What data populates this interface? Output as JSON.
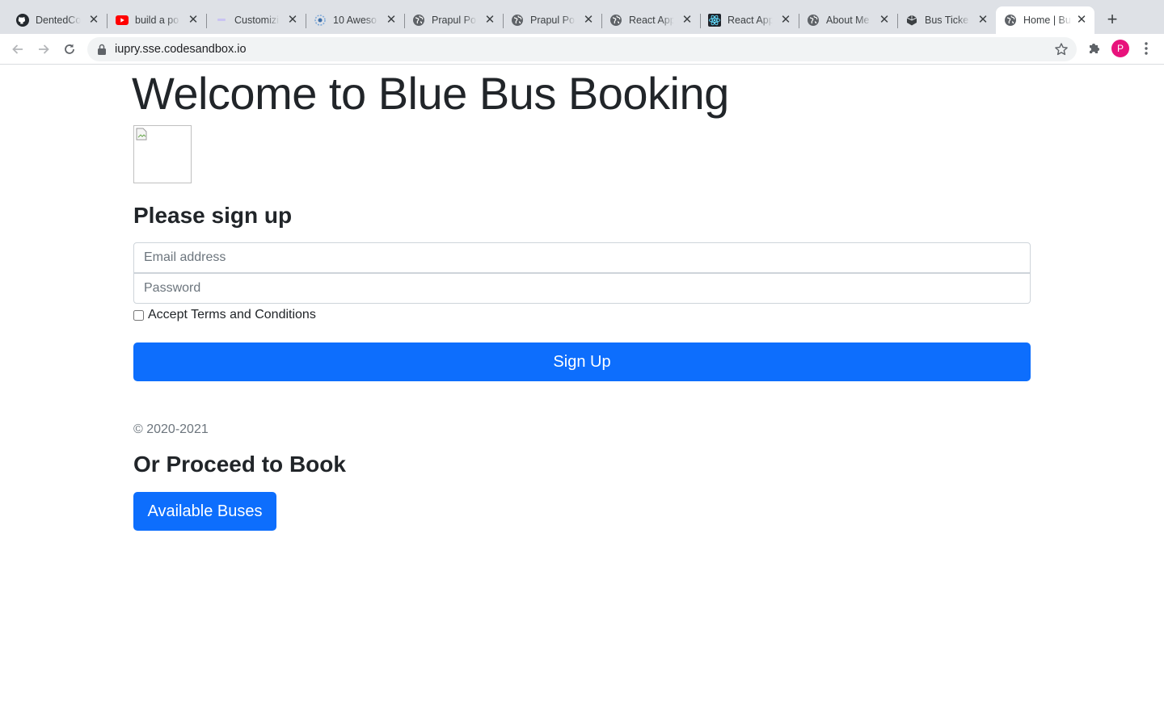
{
  "browser": {
    "tabs": [
      {
        "title": "DentedCo",
        "icon": "github-icon",
        "active": false
      },
      {
        "title": "build a po",
        "icon": "youtube-icon",
        "active": false
      },
      {
        "title": "Customizi",
        "icon": "page-icon",
        "active": false
      },
      {
        "title": "10 Aweso",
        "icon": "aweso-icon",
        "active": false
      },
      {
        "title": "Prapul Po",
        "icon": "globe-icon",
        "active": false
      },
      {
        "title": "Prapul Po",
        "icon": "globe-icon",
        "active": false
      },
      {
        "title": "React App",
        "icon": "globe-icon",
        "active": false
      },
      {
        "title": "React App",
        "icon": "react-icon",
        "active": false
      },
      {
        "title": "About Me",
        "icon": "globe-icon",
        "active": false
      },
      {
        "title": "Bus Ticke",
        "icon": "codesandbox-icon",
        "active": false
      },
      {
        "title": "Home | Bu",
        "icon": "globe-icon",
        "active": true
      }
    ],
    "close_glyph": "✕",
    "new_tab_glyph": "+",
    "url": "iupry.sse.codesandbox.io",
    "profile_initial": "P",
    "profile_color": "#e8127c"
  },
  "page": {
    "heading": "Welcome to Blue Bus Booking",
    "signup_heading": "Please sign up",
    "email_placeholder": "Email address",
    "password_placeholder": "Password",
    "terms_label": "Accept Terms and Conditions",
    "signup_button": "Sign Up",
    "copyright": "© 2020-2021",
    "proceed_heading": "Or Proceed to Book",
    "buses_button": "Available Buses"
  },
  "colors": {
    "primary": "#0d6efd",
    "text": "#212529",
    "muted": "#6c757d"
  }
}
